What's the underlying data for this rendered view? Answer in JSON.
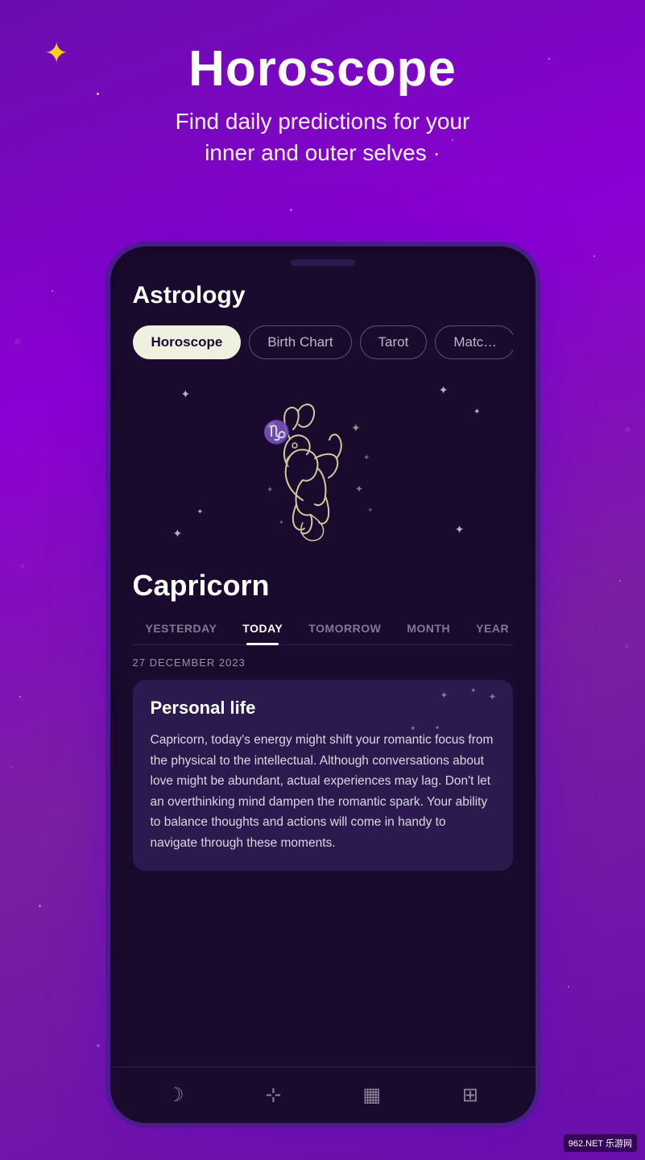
{
  "background": {
    "color_start": "#6a0dad",
    "color_end": "#8b00d4"
  },
  "header": {
    "sparkle_icon": "✦",
    "title": "Horoscope",
    "subtitle_line1": "Find daily predictions for your",
    "subtitle_line2": "inner and outer selves",
    "dot": "·"
  },
  "phone": {
    "app_title": "Astrology",
    "tabs": [
      {
        "label": "Horoscope",
        "active": true
      },
      {
        "label": "Birth Chart",
        "active": false
      },
      {
        "label": "Tarot",
        "active": false
      },
      {
        "label": "Matc",
        "active": false
      }
    ],
    "zodiac": {
      "name": "Capricorn",
      "symbol": "♑"
    },
    "time_tabs": [
      {
        "label": "YESTERDAY",
        "active": false
      },
      {
        "label": "TODAY",
        "active": true
      },
      {
        "label": "TOMORROW",
        "active": false
      },
      {
        "label": "MONTH",
        "active": false
      },
      {
        "label": "YEAR",
        "active": false
      }
    ],
    "date": "27 DECEMBER 2023",
    "prediction_card": {
      "title": "Personal life",
      "text": "Capricorn, today's energy might shift your romantic focus from the physical to the intellectual. Although conversations about love might be abundant, actual experiences may lag. Don't let an overthinking mind dampen the romantic spark. Your ability to balance thoughts and actions will come in handy to navigate through these moments."
    },
    "bottom_nav_icons": [
      "☽",
      "✦",
      "▦",
      "⊞"
    ]
  },
  "watermark": {
    "site": "962.NET",
    "platform": "乐游网"
  }
}
